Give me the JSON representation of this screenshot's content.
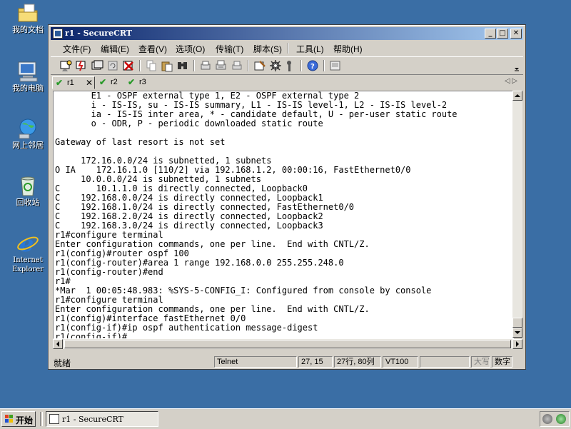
{
  "desktop": {
    "icons": [
      {
        "label": "我的文档",
        "icon": "my-documents-icon"
      },
      {
        "label": "我的电脑",
        "icon": "my-computer-icon"
      },
      {
        "label": "网上邻居",
        "icon": "network-places-icon"
      },
      {
        "label": "回收站",
        "icon": "recycle-bin-icon"
      },
      {
        "label": "Internet Explorer",
        "icon": "internet-explorer-icon"
      }
    ]
  },
  "window": {
    "title": "r1 - SecureCRT",
    "controls": {
      "minimize": "_",
      "maximize": "□",
      "close": "✕"
    },
    "menu": [
      "文件(F)",
      "编辑(E)",
      "查看(V)",
      "选项(O)",
      "传输(T)",
      "脚本(S)",
      "工具(L)",
      "帮助(H)"
    ],
    "tabs": [
      {
        "label": "r1",
        "close": "✕"
      },
      {
        "label": "r2"
      },
      {
        "label": "r3"
      }
    ],
    "tab_check": "✔",
    "tab_nav": "◁ ▷",
    "terminal_lines": [
      "       E1 - OSPF external type 1, E2 - OSPF external type 2",
      "       i - IS-IS, su - IS-IS summary, L1 - IS-IS level-1, L2 - IS-IS level-2",
      "       ia - IS-IS inter area, * - candidate default, U - per-user static route",
      "       o - ODR, P - periodic downloaded static route",
      "",
      "Gateway of last resort is not set",
      "",
      "     172.16.0.0/24 is subnetted, 1 subnets",
      "O IA    172.16.1.0 [110/2] via 192.168.1.2, 00:00:16, FastEthernet0/0",
      "     10.0.0.0/24 is subnetted, 1 subnets",
      "C       10.1.1.0 is directly connected, Loopback0",
      "C    192.168.0.0/24 is directly connected, Loopback1",
      "C    192.168.1.0/24 is directly connected, FastEthernet0/0",
      "C    192.168.2.0/24 is directly connected, Loopback2",
      "C    192.168.3.0/24 is directly connected, Loopback3",
      "r1#configure terminal",
      "Enter configuration commands, one per line.  End with CNTL/Z.",
      "r1(config)#router ospf 100",
      "r1(config-router)#area 1 range 192.168.0.0 255.255.248.0",
      "r1(config-router)#end",
      "r1#",
      "*Mar  1 00:05:48.983: %SYS-5-CONFIG_I: Configured from console by console",
      "r1#configure terminal",
      "Enter configuration commands, one per line.  End with CNTL/Z.",
      "r1(config)#interface fastEthernet 0/0",
      "r1(config-if)#ip ospf authentication message-digest",
      "r1(config-if)#"
    ],
    "status": {
      "text": "就绪",
      "protocol": "Telnet",
      "cursor": "27, 15",
      "size": "27行, 80列",
      "emulation": "VT100",
      "caps": "大写",
      "num": "数字"
    }
  },
  "taskbar": {
    "start_label": "开始",
    "task_title": "r1 - SecureCRT"
  }
}
